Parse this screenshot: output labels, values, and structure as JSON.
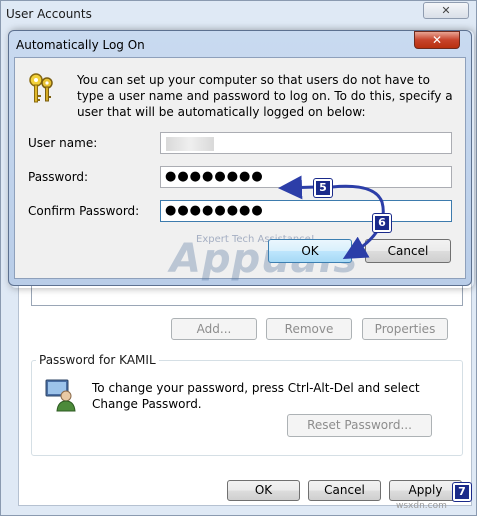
{
  "outer_window": {
    "title": "User Accounts",
    "buttons": {
      "add": "Add...",
      "remove": "Remove",
      "properties": "Properties"
    },
    "password_group": {
      "label": "Password for KAMIL",
      "text": "To change your password, press Ctrl-Alt-Del and select Change Password.",
      "reset_button": "Reset Password..."
    },
    "footer": {
      "ok": "OK",
      "cancel": "Cancel",
      "apply": "Apply"
    }
  },
  "dialog": {
    "title": "Automatically Log On",
    "description": "You can set up your computer so that users do not have to type a user name and password to log on. To do this, specify a user that will be automatically logged on below:",
    "fields": {
      "username": {
        "label": "User name:",
        "value": ""
      },
      "password": {
        "label": "Password:",
        "value": "●●●●●●●●"
      },
      "confirm": {
        "label": "Confirm Password:",
        "value": "●●●●●●●●"
      }
    },
    "ok": "OK",
    "cancel": "Cancel"
  },
  "annotations": {
    "step5": "5",
    "step6": "6",
    "step7": "7"
  },
  "watermark": {
    "brand": "Appuals",
    "tagline": "Expert Tech Assistance!"
  },
  "site_mark": "wsxdn.com",
  "colors": {
    "badge": "#1a2a8a",
    "arrow": "#2c3ea8",
    "close_red": "#c7432b"
  }
}
